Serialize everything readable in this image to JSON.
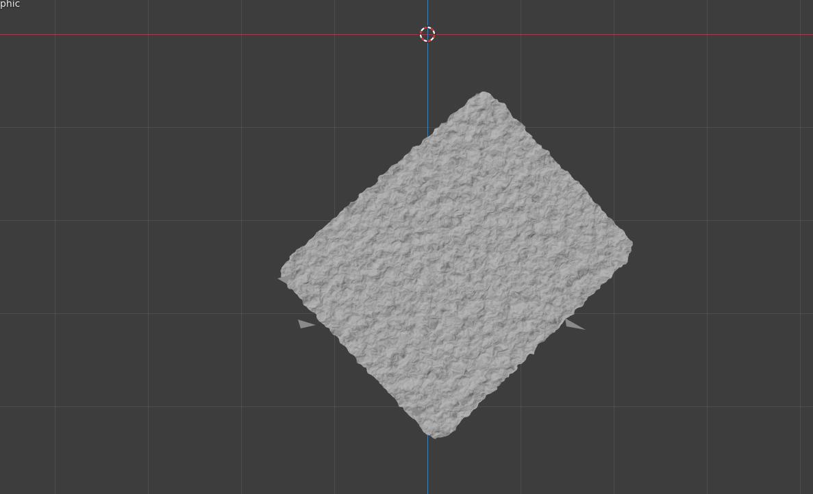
{
  "viewport": {
    "label": "phic",
    "colors": {
      "background": "#3d3d3d",
      "grid_minor": "#4a4a4a",
      "grid_major": "#555555",
      "axis_x": "#a6394a",
      "axis_z": "#3f7fb8",
      "mesh": "#8c8c8c"
    },
    "object": {
      "type": "textured-stone-plane",
      "icon": "mesh-icon"
    },
    "cursor": {
      "icon": "3d-cursor-icon"
    }
  }
}
